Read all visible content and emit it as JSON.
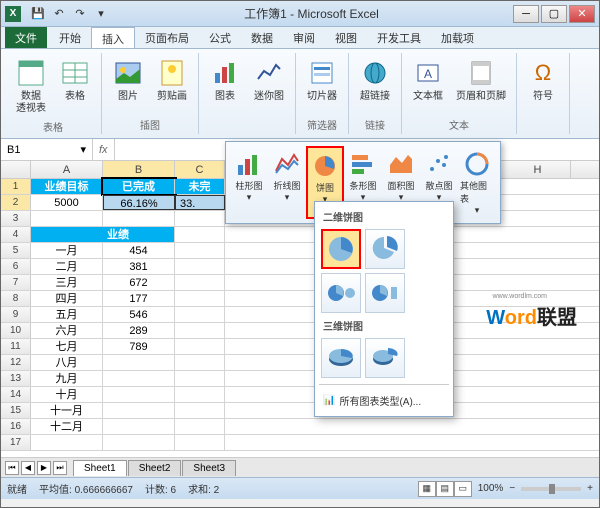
{
  "title": "工作簿1 - Microsoft Excel",
  "tabs": {
    "file": "文件",
    "home": "开始",
    "insert": "插入",
    "layout": "页面布局",
    "formulas": "公式",
    "data": "数据",
    "review": "审阅",
    "view": "视图",
    "dev": "开发工具",
    "addins": "加载项"
  },
  "ribbon": {
    "pivot": "数据\n透视表",
    "table": "表格",
    "tables_label": "表格",
    "picture": "图片",
    "clipart": "剪贴画",
    "illus_label": "插图",
    "chart": "图表",
    "sparkline": "迷你图",
    "slicer": "切片器",
    "hyperlink": "超链接",
    "filter_label": "筛选器",
    "link_label": "链接",
    "textbox": "文本框",
    "header_footer": "页眉和页脚",
    "text_label": "文本",
    "symbol": "符号"
  },
  "name_box": "B1",
  "fx": "fx",
  "cols": [
    "A",
    "B",
    "C",
    "H"
  ],
  "rows": {
    "r1": {
      "a": "业绩目标",
      "b": "已完成",
      "c": "未完"
    },
    "r2": {
      "a": "5000",
      "b": "66.16%",
      "c": "33."
    },
    "r4": {
      "b": "业绩"
    },
    "r5": {
      "a": "一月",
      "b": "454"
    },
    "r6": {
      "a": "二月",
      "b": "381"
    },
    "r7": {
      "a": "三月",
      "b": "672"
    },
    "r8": {
      "a": "四月",
      "b": "177"
    },
    "r9": {
      "a": "五月",
      "b": "546"
    },
    "r10": {
      "a": "六月",
      "b": "289"
    },
    "r11": {
      "a": "七月",
      "b": "789"
    },
    "r12": {
      "a": "八月"
    },
    "r13": {
      "a": "九月"
    },
    "r14": {
      "a": "十月"
    },
    "r15": {
      "a": "十一月"
    },
    "r16": {
      "a": "十二月"
    }
  },
  "chart_types": {
    "column": "柱形图",
    "line": "折线图",
    "pie": "饼图",
    "bar": "条形图",
    "area": "面积图",
    "scatter": "散点图",
    "other": "其他图表"
  },
  "pie_menu": {
    "sec1": "二维饼图",
    "sec2": "三维饼图",
    "all": "所有图表类型(A)..."
  },
  "sheets": {
    "s1": "Sheet1",
    "s2": "Sheet2",
    "s3": "Sheet3"
  },
  "status": {
    "ready": "就绪",
    "avg_label": "平均值:",
    "avg": "0.666666667",
    "count_label": "计数:",
    "count": "6",
    "sum_label": "求和:",
    "sum": "2",
    "zoom": "100%"
  },
  "watermark": {
    "url": "www.wordlm.com",
    "w": "W",
    "ord": "ord",
    "lm": "联盟"
  }
}
